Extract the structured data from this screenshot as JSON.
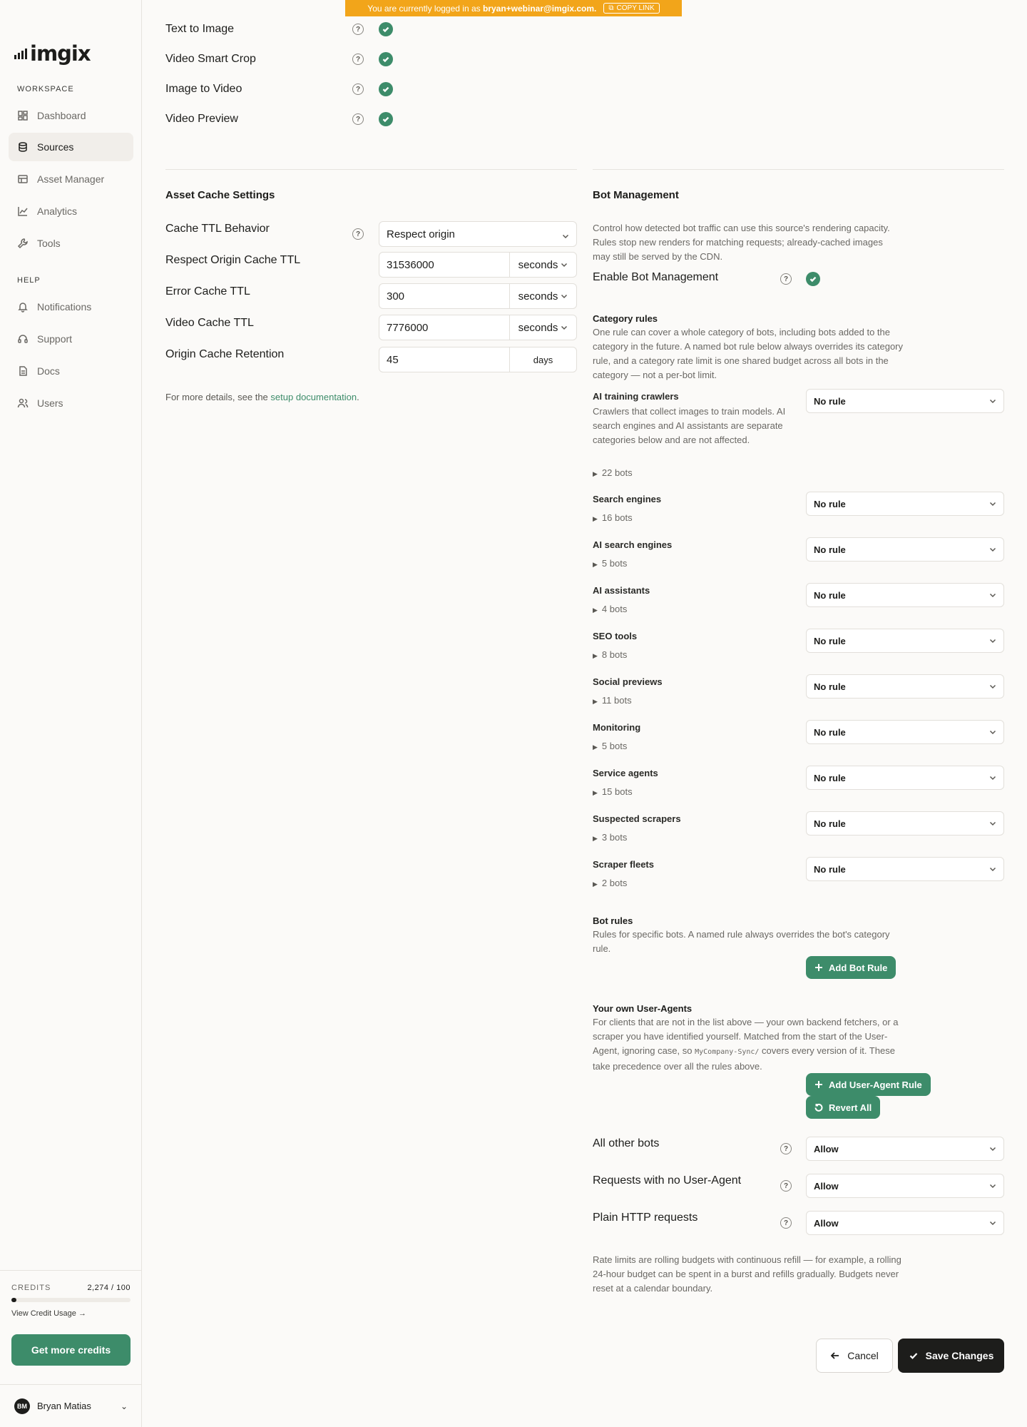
{
  "banner": {
    "prefix": "You are currently logged in as",
    "email": "bryan+webinar@imgix.com.",
    "copy_label": "COPY LINK"
  },
  "sidebar": {
    "logo": "imgix",
    "workspace_heading": "WORKSPACE",
    "workspace_items": [
      {
        "label": "Dashboard",
        "icon": "dashboard-icon"
      },
      {
        "label": "Sources",
        "icon": "database-icon"
      },
      {
        "label": "Asset Manager",
        "icon": "asset-manager-icon"
      },
      {
        "label": "Analytics",
        "icon": "analytics-icon"
      },
      {
        "label": "Tools",
        "icon": "wrench-icon"
      }
    ],
    "active_item": "Sources",
    "help_heading": "HELP",
    "help_items": [
      {
        "label": "Notifications",
        "icon": "bell-icon"
      },
      {
        "label": "Support",
        "icon": "headset-icon"
      },
      {
        "label": "Docs",
        "icon": "document-icon"
      },
      {
        "label": "Users",
        "icon": "users-icon"
      }
    ],
    "credits": {
      "label": "CREDITS",
      "value": "2,274 / 100",
      "usage_link": "View Credit Usage →",
      "cta": "Get more credits"
    },
    "user": {
      "initials": "BM",
      "name": "Bryan Matias"
    }
  },
  "features": [
    {
      "label": "Text to Image",
      "enabled": true
    },
    {
      "label": "Video Smart Crop",
      "enabled": true
    },
    {
      "label": "Image to Video",
      "enabled": true
    },
    {
      "label": "Video Preview",
      "enabled": true
    }
  ],
  "asset_cache": {
    "title": "Asset Cache Settings",
    "behavior_label": "Cache TTL Behavior",
    "behavior_value": "Respect origin",
    "fields": [
      {
        "label": "Respect Origin Cache TTL",
        "value": "31536000",
        "unit": "seconds"
      },
      {
        "label": "Error Cache TTL",
        "value": "300",
        "unit": "seconds"
      },
      {
        "label": "Video Cache TTL",
        "value": "7776000",
        "unit": "seconds"
      },
      {
        "label": "Origin Cache Retention",
        "value": "45",
        "unit": "days"
      }
    ],
    "note_prefix": "For more details, see the",
    "note_link": "setup documentation",
    "note_suffix": "."
  },
  "bot_management": {
    "title": "Bot Management",
    "description": "Control how detected bot traffic can use this source's rendering capacity. Rules stop new renders for matching requests; already-cached images may still be served by the CDN.",
    "enable_label": "Enable Bot Management",
    "enabled": true,
    "category_rules_title": "Category rules",
    "category_rules_desc": "One rule can cover a whole category of bots, including bots added to the category in the future. A named bot rule below always overrides its category rule, and a category rate limit is one shared budget across all bots in the category — not a per-bot limit.",
    "categories": [
      {
        "name": "AI training crawlers",
        "desc": "Crawlers that collect images to train models. AI search engines and AI assistants are separate categories below and are not affected.",
        "count": "22 bots",
        "rule": "No rule"
      },
      {
        "name": "Search engines",
        "desc": "",
        "count": "16 bots",
        "rule": "No rule"
      },
      {
        "name": "AI search engines",
        "desc": "",
        "count": "5 bots",
        "rule": "No rule"
      },
      {
        "name": "AI assistants",
        "desc": "",
        "count": "4 bots",
        "rule": "No rule"
      },
      {
        "name": "SEO tools",
        "desc": "",
        "count": "8 bots",
        "rule": "No rule"
      },
      {
        "name": "Social previews",
        "desc": "",
        "count": "11 bots",
        "rule": "No rule"
      },
      {
        "name": "Monitoring",
        "desc": "",
        "count": "5 bots",
        "rule": "No rule"
      },
      {
        "name": "Service agents",
        "desc": "",
        "count": "15 bots",
        "rule": "No rule"
      },
      {
        "name": "Suspected scrapers",
        "desc": "",
        "count": "3 bots",
        "rule": "No rule"
      },
      {
        "name": "Scraper fleets",
        "desc": "",
        "count": "2 bots",
        "rule": "No rule"
      }
    ],
    "bot_rules_title": "Bot rules",
    "bot_rules_desc": "Rules for specific bots. A named rule always overrides the bot's category rule.",
    "add_bot_rule": "Add Bot Rule",
    "ua_title": "Your own User-Agents",
    "ua_desc_1": "For clients that are not in the list above — your own backend fetchers, or a scraper you have identified yourself. Matched from the start of the User-Agent, ignoring case, so",
    "ua_desc_code": "MyCompany-Sync/",
    "ua_desc_2": "covers every version of it. These take precedence over all the rules above.",
    "add_ua_rule": "Add User-Agent Rule",
    "revert_all": "Revert All",
    "defaults": [
      {
        "label": "All other bots",
        "value": "Allow"
      },
      {
        "label": "Requests with no User-Agent",
        "value": "Allow"
      },
      {
        "label": "Plain HTTP requests",
        "value": "Allow"
      }
    ],
    "footnote": "Rate limits are rolling budgets with continuous refill — for example, a rolling 24-hour budget can be spent in a burst and refills gradually. Budgets never reset at a calendar boundary."
  },
  "actions": {
    "cancel": "Cancel",
    "save": "Save Changes"
  },
  "colors": {
    "accent": "#3d8c6a",
    "banner": "#f2a51a",
    "dark": "#1d1d1b"
  },
  "credits_fill_fraction": 0.02
}
